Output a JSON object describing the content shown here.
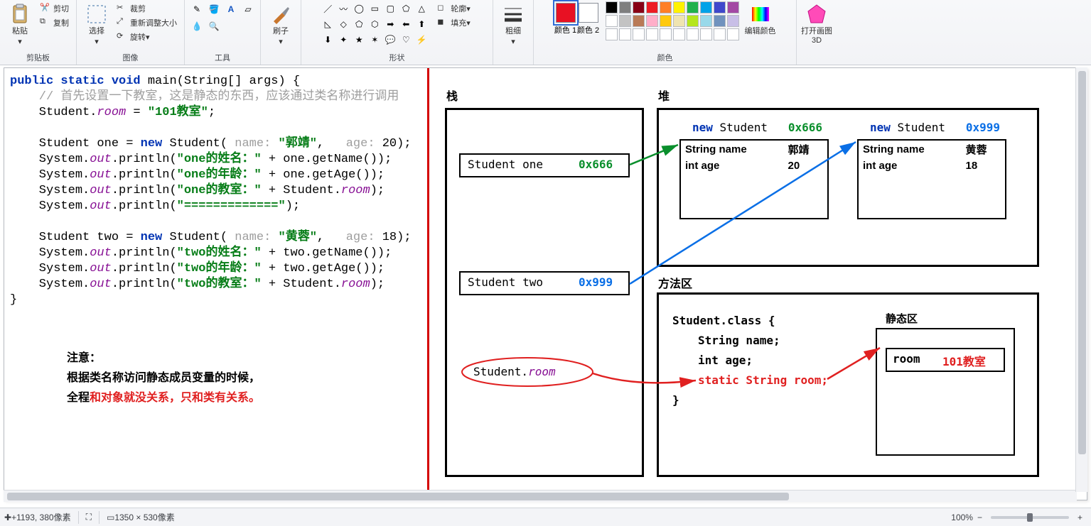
{
  "ribbon": {
    "groups": {
      "clipboard": {
        "label": "剪贴板",
        "paste": "粘贴",
        "cut": "剪切",
        "copy": "复制"
      },
      "image": {
        "label": "图像",
        "select": "选择",
        "crop": "裁剪",
        "resize": "重新调整大小",
        "rotate": "旋转"
      },
      "tools": {
        "label": "工具",
        "brushes": "刷子"
      },
      "shapes": {
        "label": "形状",
        "outline": "轮廓",
        "fill": "填充"
      },
      "size": {
        "label": "粗细"
      },
      "colors": {
        "label": "颜色",
        "color1": "颜色 1",
        "color2": "颜色 2",
        "edit": "编辑颜色"
      },
      "p3d": {
        "label": "打开画图 3D"
      }
    },
    "selected_color1": "#e81123",
    "selected_color2": "#ffffff",
    "palette": [
      "#000000",
      "#7f7f7f",
      "#880015",
      "#ed1c24",
      "#ff7f27",
      "#fff200",
      "#22b14c",
      "#00a2e8",
      "#3f48cc",
      "#a349a4",
      "#ffffff",
      "#c3c3c3",
      "#b97a57",
      "#ffaec9",
      "#ffc90e",
      "#efe4b0",
      "#b5e61d",
      "#99d9ea",
      "#7092be",
      "#c8bfe7",
      "#ffffff",
      "#ffffff",
      "#ffffff",
      "#ffffff",
      "#ffffff",
      "#ffffff",
      "#ffffff",
      "#ffffff",
      "#ffffff",
      "#ffffff"
    ]
  },
  "code": {
    "sig_pre": "public static void",
    "sig_post": " main(String[] args) {",
    "comment": "    // 首先设置一下教室，这是静态的东西，应该通过类名称进行调用",
    "l1a": "    Student.",
    "l1b": "room",
    "l1c": " = ",
    "l1d": "\"101教室\"",
    "l1e": ";",
    "one_decl_a": "    Student one = ",
    "one_decl_b": "new",
    "one_decl_c": " Student(",
    "one_decl_d": " name: ",
    "one_decl_e": "\"郭靖\"",
    "one_decl_f": ",   ",
    "one_decl_g": "age: ",
    "one_decl_h": "20);",
    "po1a": "    System.",
    "po1b": "out",
    "po1c": ".println(",
    "po1d": "\"one的姓名：\"",
    "po1e": " + one.getName());",
    "po2d": "\"one的年龄：\"",
    "po2e": " + one.getAge());",
    "po3d": "\"one的教室：\"",
    "po3e": " + Student.",
    "po3f": "room",
    "po3g": ");",
    "sep_d": "\"=============\"",
    "sep_e": ");",
    "two_decl_a": "    Student two = ",
    "two_decl_b": "new",
    "two_decl_c": " Student(",
    "two_decl_d": " name: ",
    "two_decl_e": "\"黄蓉\"",
    "two_decl_f": ",   ",
    "two_decl_g": "age: ",
    "two_decl_h": "18);",
    "pt1d": "\"two的姓名：\"",
    "pt1e": " + two.getName());",
    "pt2d": "\"two的年龄：\"",
    "pt2e": " + two.getAge());",
    "pt3d": "\"two的教室：\"",
    "close": "}"
  },
  "note": {
    "title": "注意：",
    "line1a": "根据类名称访问静态成员变量的时候，",
    "line2a": "全程",
    "line2b": "和对象就没关系，只和类有关系。"
  },
  "diagram": {
    "stack_title": "栈",
    "heap_title": "堆",
    "method_area_title": "方法区",
    "static_area_title": "静态区",
    "stack": {
      "one": {
        "label": "Student one",
        "addr": "0x666"
      },
      "two": {
        "label": "Student two",
        "addr": "0x999"
      },
      "room_ref": "Student.room",
      "room_ref_a": "Student.",
      "room_ref_b": "room"
    },
    "heap": {
      "obj1": {
        "hdr_new": "new",
        "hdr_type": " Student",
        "addr": "0x666",
        "f1": "String name",
        "v1": "郭靖",
        "f2": "int age",
        "v2": "20"
      },
      "obj2": {
        "hdr_new": "new",
        "hdr_type": " Student",
        "addr": "0x999",
        "f1": "String name",
        "v1": "黄蓉",
        "f2": "int age",
        "v2": "18"
      }
    },
    "method_area": {
      "class_hdr": "Student.class {",
      "f1": "String name;",
      "f2": "int age;",
      "f3": "static String room;",
      "close": "}"
    },
    "static_box": {
      "key": "room",
      "value": "101教室"
    }
  },
  "status": {
    "cursor_prefix": "+ ",
    "cursor": "1193, 380像素",
    "sel_size": "",
    "canvas_size": "1350 × 530像素",
    "zoom": "100%"
  },
  "chart_data": {
    "type": "diagram",
    "title": "Java static field memory layout",
    "stack": [
      {
        "var": "Student one",
        "address": "0x666"
      },
      {
        "var": "Student two",
        "address": "0x999"
      },
      {
        "expr": "Student.room"
      }
    ],
    "heap": [
      {
        "address": "0x666",
        "type": "Student",
        "fields": {
          "String name": "郭靖",
          "int age": 20
        }
      },
      {
        "address": "0x999",
        "type": "Student",
        "fields": {
          "String name": "黄蓉",
          "int age": 18
        }
      }
    ],
    "method_area": {
      "class": "Student.class",
      "fields": [
        "String name;",
        "int age;",
        "static String room;"
      ],
      "static": {
        "room": "101教室"
      }
    },
    "arrows": [
      {
        "from": "stack.one",
        "to": "heap[0x666]",
        "color": "green"
      },
      {
        "from": "stack.two",
        "to": "heap[0x999]",
        "color": "blue"
      },
      {
        "from": "stack.Student.room",
        "to": "method_area.static.room",
        "path": "via static String room;",
        "color": "red"
      }
    ]
  }
}
